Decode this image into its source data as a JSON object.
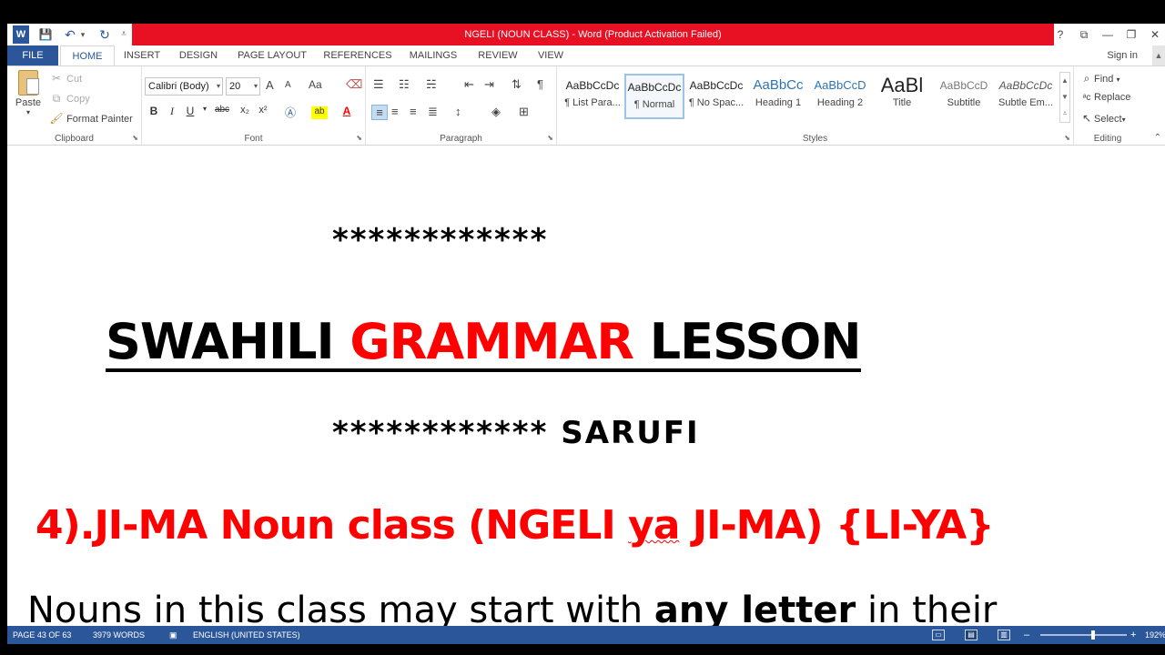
{
  "window": {
    "title": "NGELI (NOUN CLASS) -  Word (Product Activation Failed)",
    "help": "?",
    "controls": {
      "ribbon_display": "⧉",
      "minimize": "—",
      "restore": "❐",
      "close": "✕"
    }
  },
  "quick_access": {
    "app_icon": "W",
    "save": "💾",
    "undo": "↶",
    "undo_arrow": "▾",
    "redo": "↻",
    "customize": "⩡"
  },
  "tabs": [
    "FILE",
    "HOME",
    "INSERT",
    "DESIGN",
    "PAGE LAYOUT",
    "REFERENCES",
    "MAILINGS",
    "REVIEW",
    "VIEW"
  ],
  "signin": "Sign in",
  "clipboard": {
    "label": "Clipboard",
    "paste": "Paste",
    "cut": "Cut",
    "copy": "Copy",
    "format_painter": "Format Painter"
  },
  "font": {
    "label": "Font",
    "family": "Calibri (Body)",
    "size": "20",
    "grow": "A",
    "shrink": "A",
    "change_case": "Aa",
    "bold": "B",
    "italic": "I",
    "underline": "U",
    "strike": "abc",
    "subscript": "x₂",
    "superscript": "x²"
  },
  "paragraph": {
    "label": "Paragraph"
  },
  "styles": {
    "label": "Styles",
    "items": [
      {
        "sample": "AaBbCcDc",
        "name": "¶ List Para..."
      },
      {
        "sample": "AaBbCcDc",
        "name": "¶ Normal"
      },
      {
        "sample": "AaBbCcDc",
        "name": "¶ No Spac..."
      },
      {
        "sample": "AaBbCc",
        "name": "Heading 1"
      },
      {
        "sample": "AaBbCcD",
        "name": "Heading 2"
      },
      {
        "sample": "AaBl",
        "name": "Title"
      },
      {
        "sample": "AaBbCcD",
        "name": "Subtitle"
      },
      {
        "sample": "AaBbCcDc",
        "name": "Subtle Em..."
      }
    ]
  },
  "editing": {
    "label": "Editing",
    "find": "Find",
    "replace": "Replace",
    "select": "Select"
  },
  "document": {
    "stars_top": "************",
    "heading_part1": "SWAHILI ",
    "heading_red": "GRAMMAR",
    "heading_part2": " LESSON",
    "stars_bottom": "************",
    "sarufi": " SARUFI",
    "sub_part1": "4).JI-MA Noun class (NGELI ",
    "sub_ya": "ya",
    "sub_part2": " JI-MA) {LI-YA}",
    "cutoff_part1": "Nouns in this class may start with ",
    "cutoff_bold": "any letter",
    "cutoff_part2": " in their"
  },
  "status": {
    "page": "PAGE 43 OF 63",
    "words": "3979 WORDS",
    "language": "ENGLISH (UNITED STATES)",
    "zoom": "192%",
    "zoom_minus": "–",
    "zoom_plus": "+"
  },
  "colors": {
    "accent": "#2b579a",
    "title_red": "#e81123",
    "doc_red": "#ff0000"
  }
}
